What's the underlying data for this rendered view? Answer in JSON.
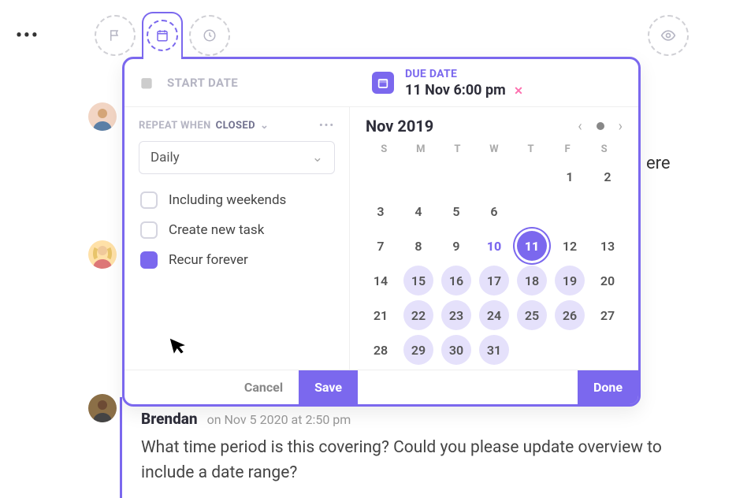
{
  "header": {
    "start_date_label": "START DATE",
    "due_date_label": "DUE DATE",
    "due_date_value": "11 Nov  6:00 pm"
  },
  "repeat": {
    "label_prefix": "REPEAT WHEN",
    "label_strong": "CLOSED",
    "frequency": "Daily",
    "options": [
      {
        "label": "Including weekends",
        "checked": false
      },
      {
        "label": "Create new task",
        "checked": false
      },
      {
        "label": "Recur forever",
        "checked": true
      }
    ]
  },
  "calendar": {
    "month_label": "Nov 2019",
    "dow": [
      "S",
      "M",
      "T",
      "W",
      "T",
      "F",
      "S"
    ],
    "selected": 11,
    "today_link": 10,
    "highlighted": [
      15,
      16,
      17,
      18,
      19,
      22,
      23,
      24,
      25,
      26,
      29,
      30,
      31
    ],
    "weeks": [
      [
        null,
        null,
        null,
        null,
        null,
        1,
        2
      ],
      [
        3,
        4,
        5,
        6,
        null,
        null,
        null
      ],
      [
        7,
        8,
        9,
        10,
        11,
        12,
        13
      ],
      [
        14,
        15,
        16,
        17,
        18,
        19,
        20
      ],
      [
        21,
        22,
        23,
        24,
        25,
        26,
        27
      ],
      [
        28,
        29,
        30,
        31,
        null,
        null,
        null
      ]
    ]
  },
  "buttons": {
    "cancel": "Cancel",
    "save": "Save",
    "done": "Done"
  },
  "bg_text": "ere",
  "comment": {
    "author": "Brendan",
    "timestamp": "on Nov 5 2020 at 2:50 pm",
    "body": "What time period is this covering? Could you please update overview to include a date range?"
  }
}
